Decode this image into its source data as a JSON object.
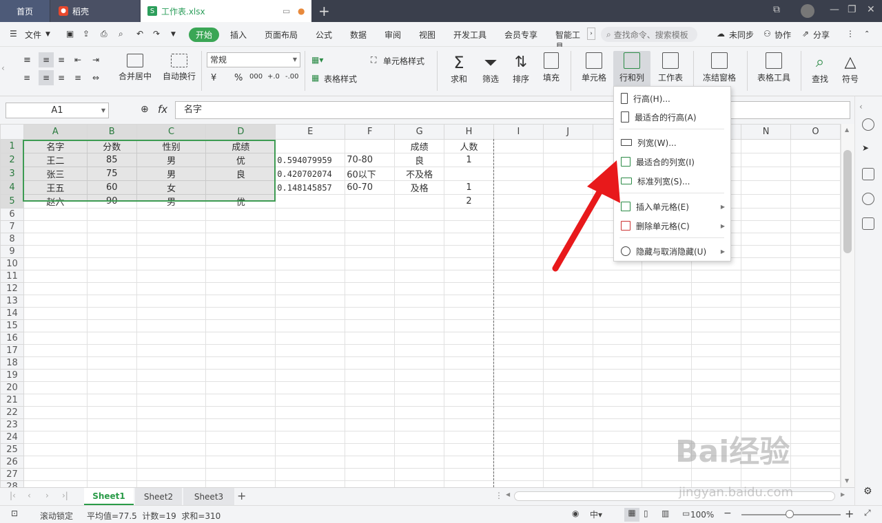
{
  "titlebar": {
    "home_tab": "首页",
    "wps_tab": "稻壳",
    "doc_tab": "工作表.xlsx",
    "doc_icon": "S",
    "new_tab": "+"
  },
  "menu": {
    "file": "文件",
    "start": "开始",
    "items": [
      "插入",
      "页面布局",
      "公式",
      "数据",
      "审阅",
      "视图",
      "开发工具",
      "会员专享",
      "智能工具"
    ],
    "search_placeholder": "查找命令、搜索模板",
    "unsync": "未同步",
    "collab": "协作",
    "share": "分享"
  },
  "ribbon": {
    "merge_center": "合并居中",
    "auto_wrap": "自动换行",
    "number_format": "常规",
    "currency": "¥",
    "percent": "%",
    "thousand": "000",
    "dec_inc": "+.0",
    "dec_dec": "-.00",
    "table_style": "表格样式",
    "cell_style": "单元格样式",
    "sum": "求和",
    "filter": "筛选",
    "sort": "排序",
    "fill": "填充",
    "cell": "单元格",
    "row_col": "行和列",
    "worksheet": "工作表",
    "freeze": "冻结窗格",
    "table_tools": "表格工具",
    "find": "查找",
    "symbol": "符号"
  },
  "formula_bar": {
    "cell_ref": "A1",
    "fx": "fx",
    "content": "名字"
  },
  "sheet": {
    "columns": [
      "A",
      "B",
      "C",
      "D",
      "E",
      "F",
      "G",
      "H",
      "I",
      "J",
      "K",
      "L",
      "M",
      "N",
      "O"
    ],
    "rows": [
      [
        "名字",
        "分数",
        "性别",
        "成绩",
        "",
        "",
        "成绩",
        "人数",
        "",
        "",
        "",
        "",
        "",
        "",
        ""
      ],
      [
        "王二",
        "85",
        "男",
        "优",
        "0.594079959",
        "70-80",
        "良",
        "1",
        "",
        "",
        "",
        "",
        "",
        "",
        ""
      ],
      [
        "张三",
        "75",
        "男",
        "良",
        "0.420702074",
        "60以下",
        "不及格",
        "",
        "",
        "",
        "",
        "",
        "",
        "",
        ""
      ],
      [
        "王五",
        "60",
        "女",
        "",
        "0.148145857",
        "60-70",
        "及格",
        "1",
        "",
        "",
        "",
        "",
        "",
        "",
        ""
      ],
      [
        "赵六",
        "90",
        "男",
        "优",
        "",
        "",
        "",
        "2",
        "",
        "",
        "",
        "",
        "",
        "",
        ""
      ]
    ],
    "total_rows": 28
  },
  "dropdown": {
    "items": [
      {
        "label": "行高(H)...",
        "icon": "row-height-icon",
        "submenu": false
      },
      {
        "label": "最适合的行高(A)",
        "icon": "autofit-row-icon",
        "submenu": false
      },
      {
        "label": "列宽(W)...",
        "icon": "column-width-icon",
        "submenu": false
      },
      {
        "label": "最适合的列宽(I)",
        "icon": "autofit-column-icon",
        "submenu": false
      },
      {
        "label": "标准列宽(S)...",
        "icon": "standard-width-icon",
        "submenu": false
      },
      {
        "label": "插入单元格(E)",
        "icon": "insert-cell-icon",
        "submenu": true
      },
      {
        "label": "删除单元格(C)",
        "icon": "delete-cell-icon",
        "submenu": true
      },
      {
        "label": "隐藏与取消隐藏(U)",
        "icon": "hide-icon",
        "submenu": true
      }
    ]
  },
  "sheet_tabs": [
    "Sheet1",
    "Sheet2",
    "Sheet3"
  ],
  "status": {
    "scroll_lock": "滚动锁定",
    "stats": "平均值=77.5  计数=19  求和=310",
    "zoom": "100%"
  },
  "watermark": {
    "brand": "Bai经验",
    "url": "jingyan.baidu.com"
  },
  "colors": {
    "accent": "#3aa655",
    "selection": "#3d9b52",
    "arrow": "#e8191b"
  }
}
